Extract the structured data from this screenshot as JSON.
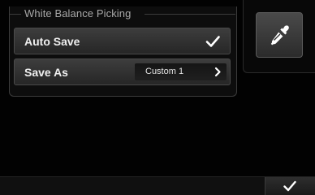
{
  "panel": {
    "title": "White Balance Picking",
    "auto_save": {
      "label": "Auto Save",
      "checked": true,
      "icon": "check-icon"
    },
    "save_as": {
      "label": "Save As",
      "value": "Custom 1",
      "icon": "chevron-right-icon"
    }
  },
  "tools": {
    "eyedropper": {
      "icon": "eyedropper-icon"
    }
  },
  "footer": {
    "confirm": {
      "icon": "check-icon"
    }
  },
  "colors": {
    "background": "#000000",
    "row": "#333333",
    "text": "#f0f0f0",
    "legend": "#a8a8a8"
  }
}
